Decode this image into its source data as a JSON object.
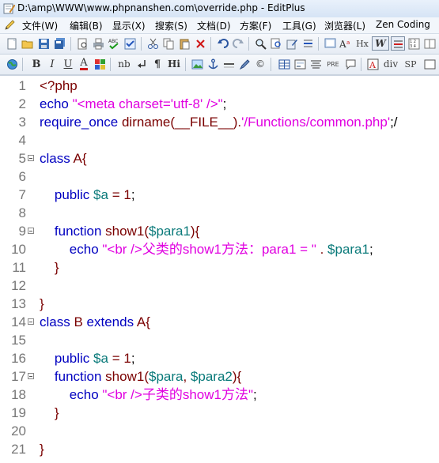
{
  "window": {
    "title": "D:\\amp\\WWW\\www.phpnanshen.com\\override.php - EditPlus"
  },
  "menu": [
    "文件(W)",
    "编辑(B)",
    "显示(X)",
    "搜索(S)",
    "文档(D)",
    "方案(F)",
    "工具(G)",
    "浏览器(L)",
    "Zen Coding"
  ],
  "toolbar2_labels": {
    "bold": "B",
    "italic": "I",
    "underline": "U",
    "font": "A",
    "nb": "nb",
    "pre": "PRE",
    "div": "div",
    "sp": "SP",
    "hi": "Hi",
    "hx": "Hx",
    "w": "W"
  },
  "colors": {
    "keyword": "#0000c0",
    "function": "#7a0000",
    "variable": "#0a7a7a",
    "string": "#e000e0"
  },
  "code_lines": [
    {
      "n": "1",
      "fold": false
    },
    {
      "n": "2",
      "fold": false
    },
    {
      "n": "3",
      "fold": false
    },
    {
      "n": "4",
      "fold": false
    },
    {
      "n": "5",
      "fold": true
    },
    {
      "n": "6",
      "fold": false
    },
    {
      "n": "7",
      "fold": false
    },
    {
      "n": "8",
      "fold": false
    },
    {
      "n": "9",
      "fold": true
    },
    {
      "n": "10",
      "fold": false
    },
    {
      "n": "11",
      "fold": false
    },
    {
      "n": "12",
      "fold": false
    },
    {
      "n": "13",
      "fold": false
    },
    {
      "n": "14",
      "fold": true
    },
    {
      "n": "15",
      "fold": false
    },
    {
      "n": "16",
      "fold": false
    },
    {
      "n": "17",
      "fold": true
    },
    {
      "n": "18",
      "fold": false
    },
    {
      "n": "19",
      "fold": false
    },
    {
      "n": "20",
      "fold": false
    },
    {
      "n": "21",
      "fold": false
    }
  ],
  "code": {
    "l1": "<?php",
    "l2_a": "echo ",
    "l2_b": "\"<meta charset='utf-8' />\"",
    "l2_c": ";",
    "l3_a": "require_once ",
    "l3_b": "dirname",
    "l3_c": "(__FILE__).",
    "l3_d": "'/Functions/common.php'",
    "l3_e": ";/",
    "l5_a": "class ",
    "l5_b": "A",
    "l5_c": "{",
    "l7_a": "    public ",
    "l7_b": "$a",
    "l7_c": " = ",
    "l7_d": "1",
    "l7_e": ";",
    "l9_a": "    function ",
    "l9_b": "show1",
    "l9_c": "(",
    "l9_d": "$para1",
    "l9_e": "){",
    "l10_a": "        echo ",
    "l10_b": "\"<br />父类的show1方法：para1 = \"",
    "l10_c": " . ",
    "l10_d": "$para1",
    "l10_e": ";",
    "l11": "    }",
    "l13": "}",
    "l14_a": "class ",
    "l14_b": "B",
    "l14_c": " extends ",
    "l14_d": "A",
    "l14_e": "{",
    "l16_a": "    public ",
    "l16_b": "$a",
    "l16_c": " = ",
    "l16_d": "1",
    "l16_e": ";",
    "l17_a": "    function ",
    "l17_b": "show1",
    "l17_c": "(",
    "l17_d": "$para",
    "l17_e": ", ",
    "l17_f": "$para2",
    "l17_g": "){",
    "l18_a": "        echo ",
    "l18_b": "\"<br />子类的show1方法\"",
    "l18_c": ";",
    "l19": "    }",
    "l21": "}"
  }
}
